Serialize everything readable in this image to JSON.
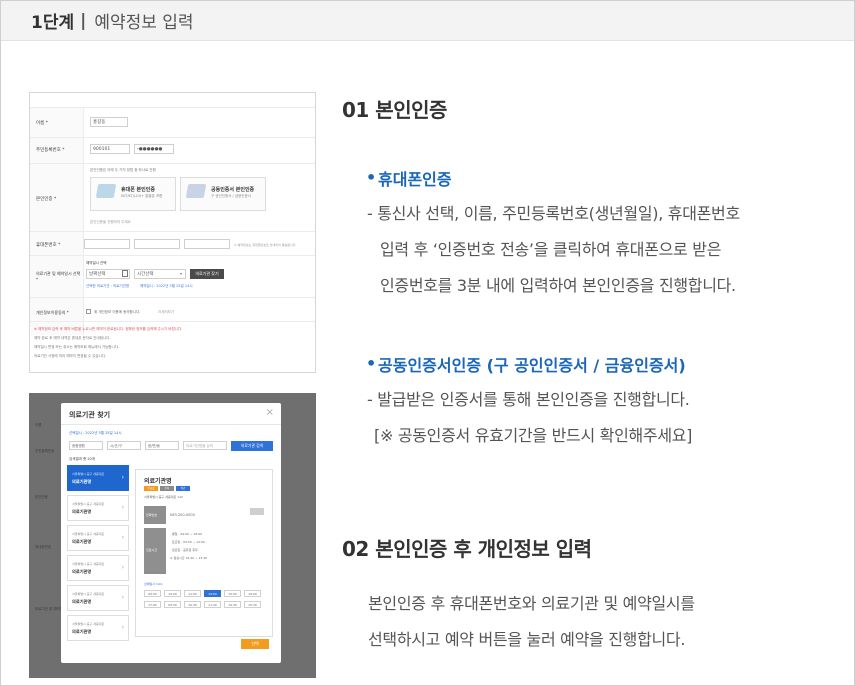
{
  "step": {
    "number": "1단계",
    "separator": "|",
    "title": "예약정보 입력"
  },
  "form_shot": {
    "labels": [
      "이름 *",
      "주민등록번호 *",
      "본인인증 *",
      "휴대폰번호 *",
      "의료기관 및 예약일시 선택 *",
      "개인정보이용동의 *"
    ],
    "name_value": "홍길동",
    "rrn_front": "900101",
    "rrn_back": "-●●●●●●",
    "auth_hint": "본인인증은 아래 두 가지 방법 중 하나로 진행",
    "card1_title": "휴대폰 본인인증",
    "card1_sub": "SKT/KT/LGU+ 알뜰폰 포함",
    "card2_title": "공동인증서 본인인증",
    "card2_sub": "구 공인인증서 / 금융인증서",
    "auth_done": "본인인증을 진행하여 주세요",
    "phone_note": "※ 예약정보는 휴대폰번호로 안내되어 발송됩니다.",
    "date_label": "예약일시 선택",
    "date_placeholder": "날짜선택",
    "time_placeholder": "시간선택",
    "search_btn": "의료기관 찾기",
    "picked_left": "선택한 의료기관 : 의료기관명",
    "picked_right": "예약일시 : 2022년 5월 25일 14시",
    "agree_text": "위 개인정보 이용에 동의합니다.",
    "agree_link": "자세히보기",
    "red_note": "※ 예약정보 입력 후 예약 버튼을 누르시면 예약이 완료됩니다. 정확한 정보를 입력해 주시기 바랍니다.",
    "gray_notes": [
      "예약 완료 후 예약 내역은 휴대폰 문자로 안내됩니다.",
      "예약일시 변경 또는 취소는 예약조회 메뉴에서 가능합니다.",
      "의료기관 사정에 따라 예약이 변경될 수 있습니다."
    ]
  },
  "modal_shot": {
    "title": "의료기관 찾기",
    "close": "×",
    "date_line": "선택일시 : 2022년 5월 25일 14시",
    "selects": [
      "종합병원",
      "시/군/구",
      "읍/면/동",
      "의료기관명을 입력"
    ],
    "search_btn": "의료기관 검색",
    "result_count": "검색결과 총 20개",
    "bg_labels": [
      "이름",
      "주민등록번호",
      "본인인증",
      "휴대폰번호",
      "의료기관 및 예약일시"
    ],
    "items": [
      {
        "sub": "서울특별시 중구 세종대로",
        "name": "의료기관명"
      },
      {
        "sub": "서울특별시 중구 세종대로",
        "name": "의료기관명"
      },
      {
        "sub": "서울특별시 중구 세종대로",
        "name": "의료기관명"
      },
      {
        "sub": "서울특별시 중구 세종대로",
        "name": "의료기관명"
      },
      {
        "sub": "서울특별시 중구 세종대로",
        "name": "의료기관명"
      },
      {
        "sub": "서울특별시 중구 세종대로",
        "name": "의료기관명"
      }
    ],
    "detail_title": "의료기관명",
    "badges": [
      "응급실",
      "주차",
      "야간"
    ],
    "addr": "서울특별시 중구 세종대로 110",
    "phone_label": "전화번호",
    "phone_value": "063-200-0000",
    "hours_label": "진료시간",
    "hours_lines": [
      "· 평일 : 09:00 ~ 18:00",
      "· 토요일 : 09:00 ~ 13:00",
      "· 일요일 · 공휴일 휴무",
      "※ 점심시간 12:30 ~ 13:30"
    ],
    "slot_date": "선택일시 14시",
    "slots": [
      "09:00",
      "10:00",
      "11:00",
      "14:00",
      "15:00",
      "16:00",
      "17:00",
      "09:30",
      "10:30",
      "11:30",
      "14:30",
      "15:30"
    ],
    "select_btn": "선택"
  },
  "section1": {
    "heading": "01 본인인증",
    "m1_bullet": "•",
    "m1_title": "휴대폰인증",
    "m1_lines": [
      "- 통신사 선택, 이름, 주민등록번호(생년월일), 휴대폰번호",
      "입력 후 ‘인증번호 전송’을 클릭하여 휴대폰으로 받은",
      "인증번호를 3분 내에 입력하여 본인인증을 진행합니다."
    ],
    "m2_bullet": "•",
    "m2_title": "공동인증서인증 (구 공인인증서 / 금융인증서)",
    "m2_lines": [
      "- 발급받은 인증서를 통해 본인인증을 진행합니다.",
      "[※ 공동인증서 유효기간을 반드시 확인해주세요]"
    ]
  },
  "section2": {
    "heading": "02 본인인증 후 개인정보 입력",
    "lines": [
      "본인인증 후 휴대폰번호와 의료기관 및 예약일시를",
      "선택하시고 예약 버튼을 눌러 예약을 진행합니다."
    ]
  }
}
